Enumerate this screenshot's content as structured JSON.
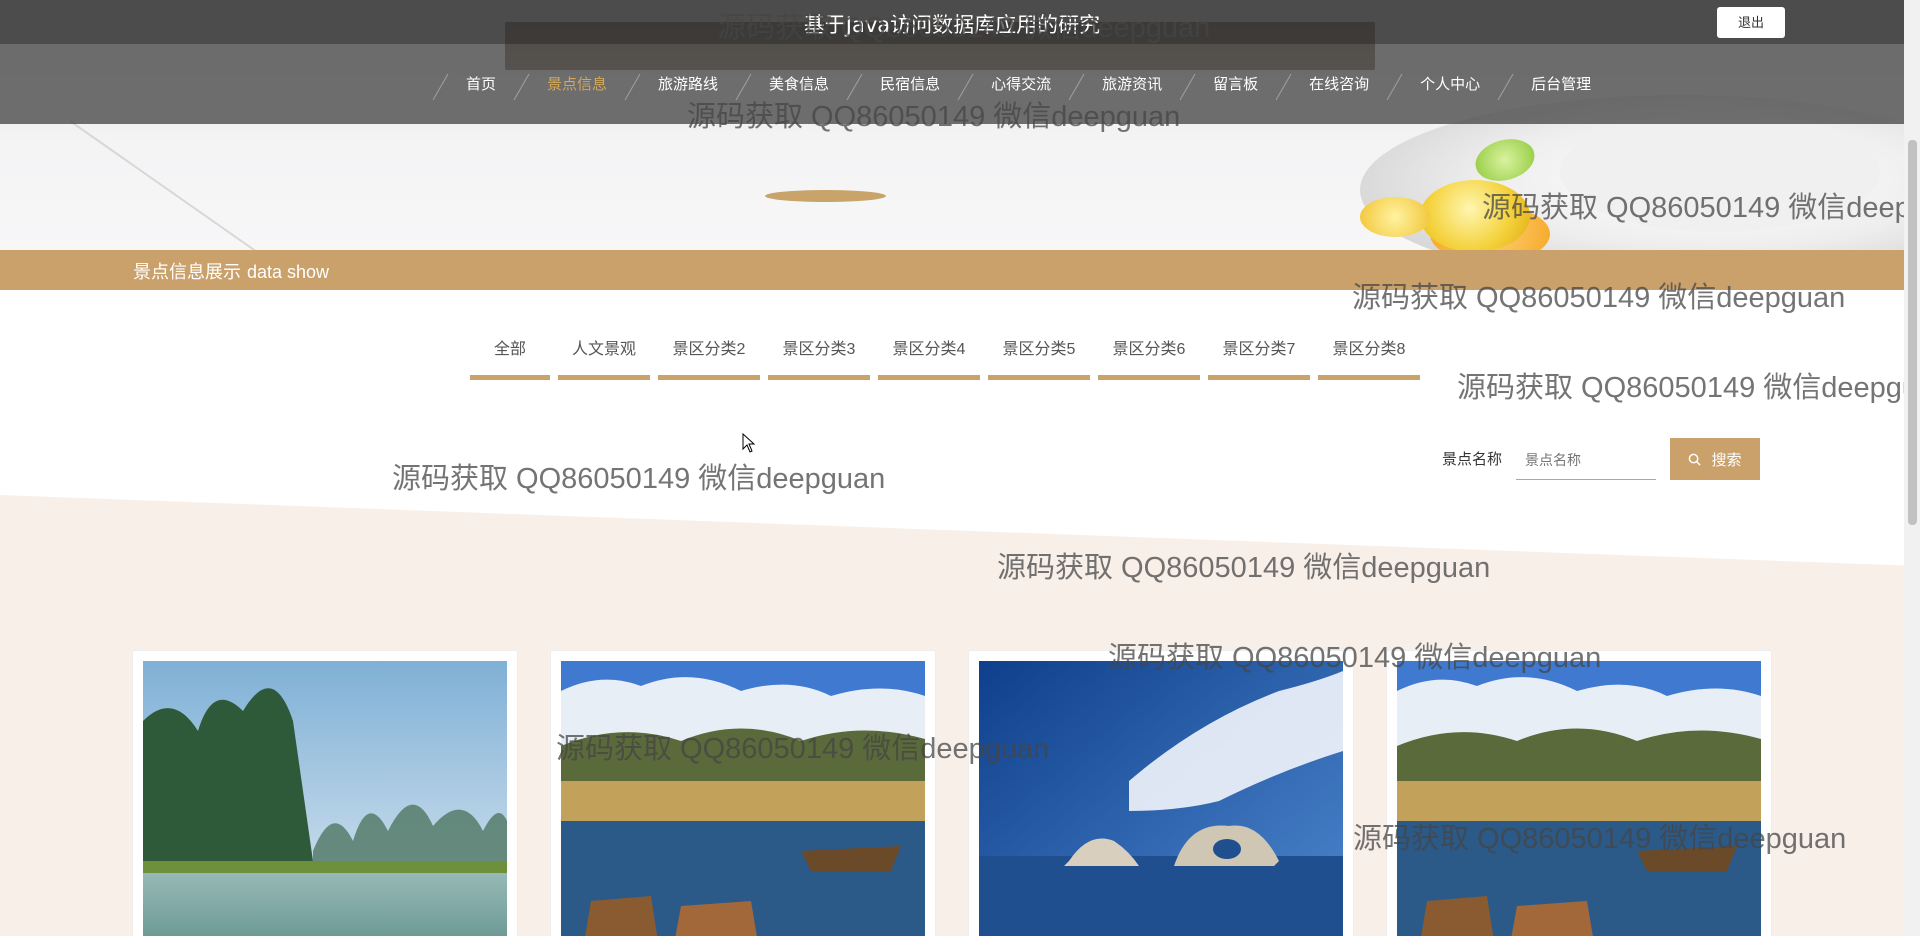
{
  "site": {
    "title": "基于Java访问数据库应用的研究",
    "logout_label": "退出"
  },
  "nav": {
    "items": [
      {
        "label": "首页",
        "active": false
      },
      {
        "label": "景点信息",
        "active": true
      },
      {
        "label": "旅游路线",
        "active": false
      },
      {
        "label": "美食信息",
        "active": false
      },
      {
        "label": "民宿信息",
        "active": false
      },
      {
        "label": "心得交流",
        "active": false
      },
      {
        "label": "旅游资讯",
        "active": false
      },
      {
        "label": "留言板",
        "active": false
      },
      {
        "label": "在线咨询",
        "active": false
      },
      {
        "label": "个人中心",
        "active": false
      },
      {
        "label": "后台管理",
        "active": false
      }
    ]
  },
  "section": {
    "title": "景点信息展示",
    "subtitle": "data show"
  },
  "categories": [
    "全部",
    "人文景观",
    "景区分类2",
    "景区分类3",
    "景区分类4",
    "景区分类5",
    "景区分类6",
    "景区分类7",
    "景区分类8"
  ],
  "search": {
    "label": "景点名称",
    "placeholder": "景点名称",
    "button_label": "搜索"
  },
  "cards": [
    {
      "image": "karst-river-mountains"
    },
    {
      "image": "lake-with-boats"
    },
    {
      "image": "sea-rock-arch-blue-sky"
    },
    {
      "image": "lake-with-boats"
    }
  ],
  "watermark": "源码获取 QQ86050149 微信deepguan",
  "colors": {
    "accent": "#caa16a",
    "topbar": "#363636",
    "content_bg": "#f7efe8"
  }
}
